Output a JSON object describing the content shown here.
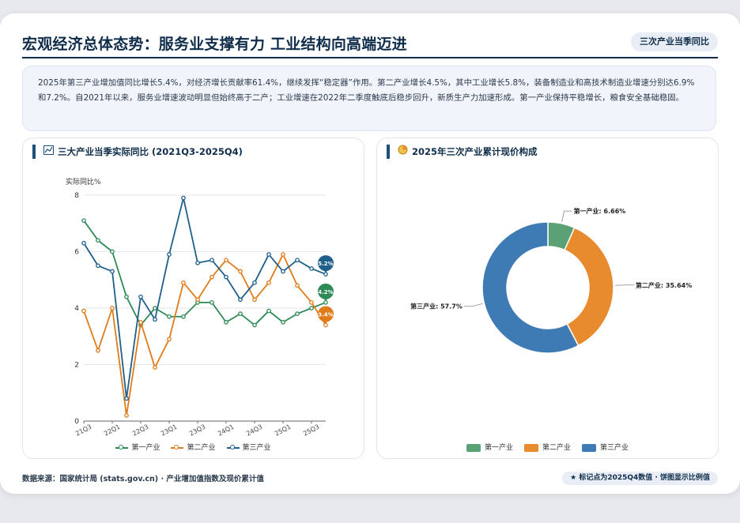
{
  "header": {
    "title": "宏观经济总体态势：服务业支撑有力 工业结构向高端迈进",
    "badge": "三次产业当季同比"
  },
  "summary": "2025年第三产业增加值同比增长5.4%，对经济增长贡献率61.4%，继续发挥“稳定器”作用。第二产业增长4.5%，其中工业增长5.8%，装备制造业和高技术制造业增速分别达6.9%和7.2%。自2021年以来，服务业增速波动明显但始终高于二产；工业增速在2022年二季度触底后稳步回升，新质生产力加速形成。第一产业保持平稳增长，粮食安全基础稳固。",
  "footer": {
    "source": "数据来源：国家统计局 (stats.gov.cn) · 产业增加值指数及现价累计值",
    "note": "★ 标记点为2025Q4数值 · 饼图显示比例值"
  },
  "colors": {
    "primary": "#2e8b57",
    "secondary": "#e07b1a",
    "tertiary": "#1f5f8b"
  },
  "chart_data": [
    {
      "type": "line",
      "title": "三大产业当季实际同比 (2021Q3-2025Q4)",
      "title_icon": "chart-icon",
      "ylabel": "实际同比%",
      "ylim": [
        0,
        8
      ],
      "yticks": [
        "0",
        "2",
        "4",
        "6",
        "8"
      ],
      "x": [
        "21Q3",
        "21Q4",
        "22Q1",
        "22Q2",
        "22Q3",
        "22Q4",
        "23Q1",
        "23Q2",
        "23Q3",
        "23Q4",
        "24Q1",
        "24Q2",
        "24Q3",
        "24Q4",
        "25Q1",
        "25Q2",
        "25Q3",
        "25Q4"
      ],
      "xtick_labels": [
        "21Q3",
        "22Q1",
        "22Q3",
        "23Q1",
        "23Q3",
        "24Q1",
        "24Q3",
        "25Q1",
        "25Q3"
      ],
      "grid": true,
      "series": [
        {
          "name": "第一产业",
          "color": "#2e8b57",
          "values": [
            7.1,
            6.4,
            6.0,
            4.4,
            3.4,
            4.0,
            3.7,
            3.7,
            4.2,
            4.2,
            3.5,
            3.8,
            3.4,
            3.9,
            3.5,
            3.8,
            4.0,
            4.2
          ],
          "end_label": "4.2%"
        },
        {
          "name": "第二产业",
          "color": "#e07b1a",
          "values": [
            3.9,
            2.5,
            4.0,
            0.2,
            3.5,
            1.9,
            2.9,
            4.9,
            4.3,
            5.1,
            5.7,
            5.3,
            4.3,
            4.9,
            5.9,
            4.8,
            4.2,
            3.4
          ],
          "end_label": "3.4%"
        },
        {
          "name": "第三产业",
          "color": "#1f5f8b",
          "values": [
            6.3,
            5.5,
            5.3,
            0.8,
            4.4,
            3.6,
            5.9,
            7.9,
            5.6,
            5.7,
            5.1,
            4.3,
            4.9,
            5.9,
            5.3,
            5.7,
            5.4,
            5.2
          ],
          "end_label": "5.2%"
        }
      ],
      "legend": "bottom"
    },
    {
      "type": "pie",
      "title": "2025年三次产业累计现价构成",
      "title_icon": "pie-icon",
      "donut": true,
      "slices": [
        {
          "name": "第一产业",
          "value": 6.66,
          "label": "第一产业: 6.66%",
          "color": "#5aa276"
        },
        {
          "name": "第二产业",
          "value": 35.64,
          "label": "第二产业: 35.64%",
          "color": "#e88b2e"
        },
        {
          "name": "第三产业",
          "value": 57.7,
          "label": "第三产业: 57.7%",
          "color": "#3e7ab3"
        }
      ],
      "legend": "bottom"
    }
  ]
}
